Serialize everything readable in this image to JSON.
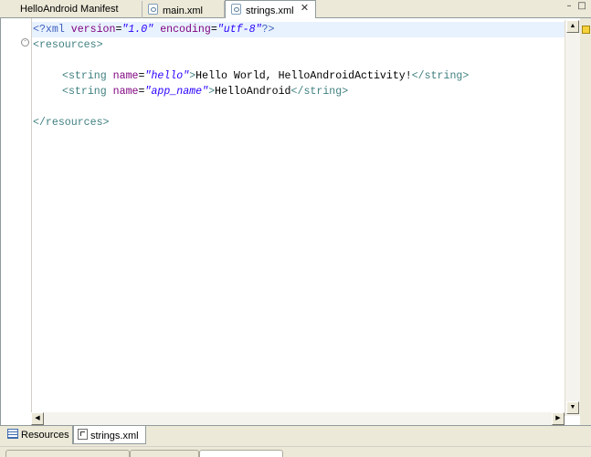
{
  "tabs": [
    {
      "label": "HelloAndroid Manifest"
    },
    {
      "label": "main.xml"
    },
    {
      "label": "strings.xml",
      "active": true
    }
  ],
  "code": {
    "line1": {
      "p1": "<?xml ",
      "a1": "version",
      "eq1": "=",
      "v1": "\"1.0\"",
      "sp": " ",
      "a2": "encoding",
      "eq2": "=",
      "v2": "\"utf-8\"",
      "p2": "?>"
    },
    "line2": {
      "t": "<resources>"
    },
    "line4": {
      "t1": "<string ",
      "a": "name",
      "eq": "=",
      "v": "\"hello\"",
      "t2": ">",
      "txt": "Hello World, HelloAndroidActivity!",
      "t3": "</string>"
    },
    "line5": {
      "t1": "<string ",
      "a": "name",
      "eq": "=",
      "v": "\"app_name\"",
      "t2": ">",
      "txt": "HelloAndroid",
      "t3": "</string>"
    },
    "line7": {
      "t": "</resources>"
    }
  },
  "bottom_tabs": [
    {
      "label": "Resources"
    },
    {
      "label": "strings.xml",
      "active": true
    }
  ],
  "icons": {
    "tab_icon": "xml-file-icon",
    "close": "close-icon",
    "fold": "fold-collapse-icon",
    "warning_marker": "overview-marker-icon",
    "resources_tab": "resources-list-icon",
    "source_tab": "source-file-icon"
  },
  "colors": {
    "tag": "#3f7f7f",
    "attribute": "#7f007f",
    "value": "#2a00ff",
    "processing": "#3f5fbf",
    "current_line": "#e8f2fe"
  }
}
